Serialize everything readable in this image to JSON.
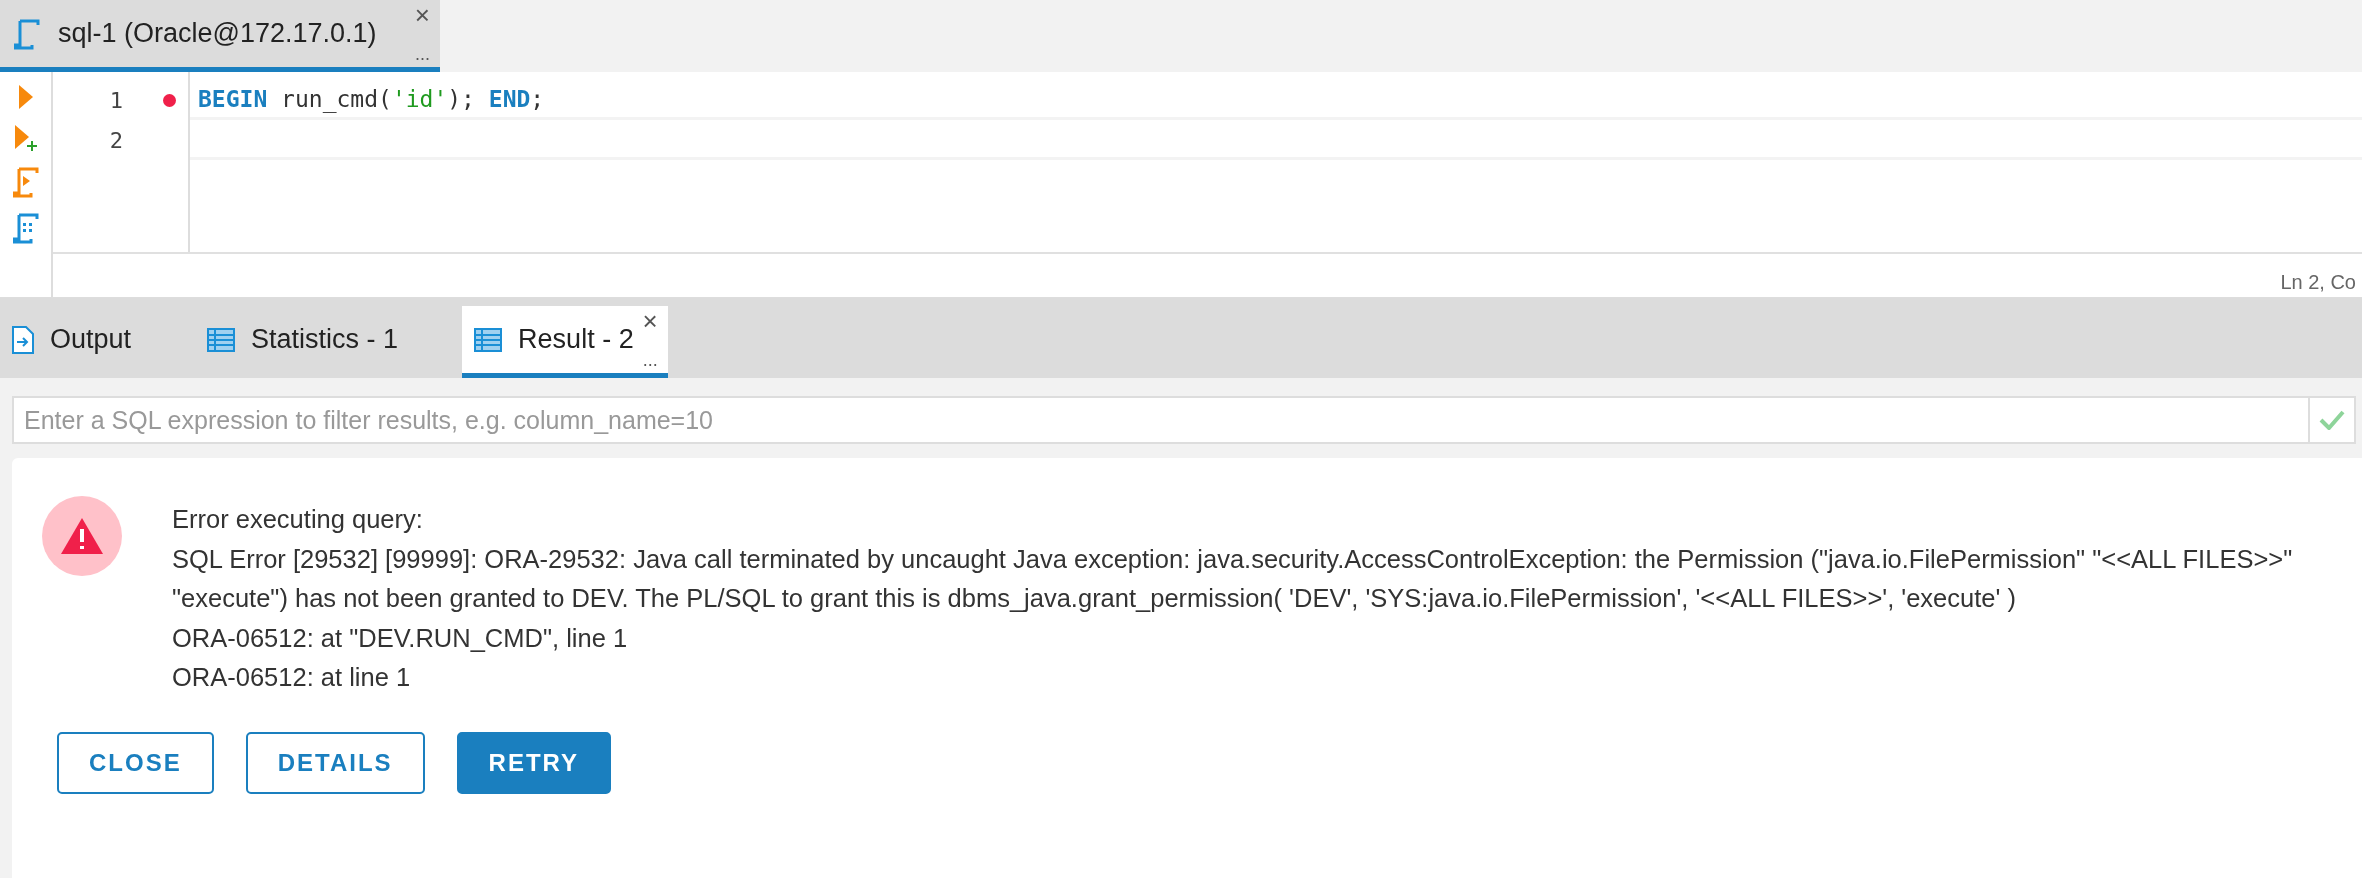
{
  "editor_tab": {
    "title": "sql-1 (Oracle@172.17.0.1)",
    "close": "×",
    "more": "...",
    "selected": true
  },
  "editor": {
    "lines": [
      {
        "number": "1",
        "breakpoint": true,
        "tokens": [
          {
            "kind": "keyword",
            "text": "BEGIN"
          },
          {
            "kind": "plain",
            "text": " run_cmd("
          },
          {
            "kind": "string",
            "text": "'id'"
          },
          {
            "kind": "plain",
            "text": "); "
          },
          {
            "kind": "keyword",
            "text": "END"
          },
          {
            "kind": "plain",
            "text": ";"
          }
        ]
      },
      {
        "number": "2",
        "breakpoint": false
      }
    ],
    "status": "Ln 2, Co"
  },
  "result_tabs": [
    {
      "label": "Output",
      "selected": false
    },
    {
      "label": "Statistics - 1",
      "selected": false
    },
    {
      "label": "Result - 2",
      "selected": true,
      "close": "×",
      "more": "..."
    }
  ],
  "filter": {
    "placeholder": "Enter a SQL expression to filter results, e.g. column_name=10"
  },
  "error": {
    "lines": [
      "Error executing query:",
      "SQL Error [29532] [99999]: ORA-29532: Java call terminated by uncaught Java exception: java.security.AccessControlException: the Permission (\"java.io.FilePermission\" \"<<ALL FILES>>\" \"execute\") has not been granted to DEV. The PL/SQL to grant this is dbms_java.grant_permission( 'DEV', 'SYS:java.io.FilePermission', '<<ALL FILES>>', 'execute' )",
      "ORA-06512: at \"DEV.RUN_CMD\", line 1",
      "ORA-06512: at line 1"
    ],
    "buttons": [
      {
        "label": "CLOSE",
        "primary": false
      },
      {
        "label": "DETAILS",
        "primary": false
      },
      {
        "label": "RETRY",
        "primary": true
      }
    ]
  }
}
